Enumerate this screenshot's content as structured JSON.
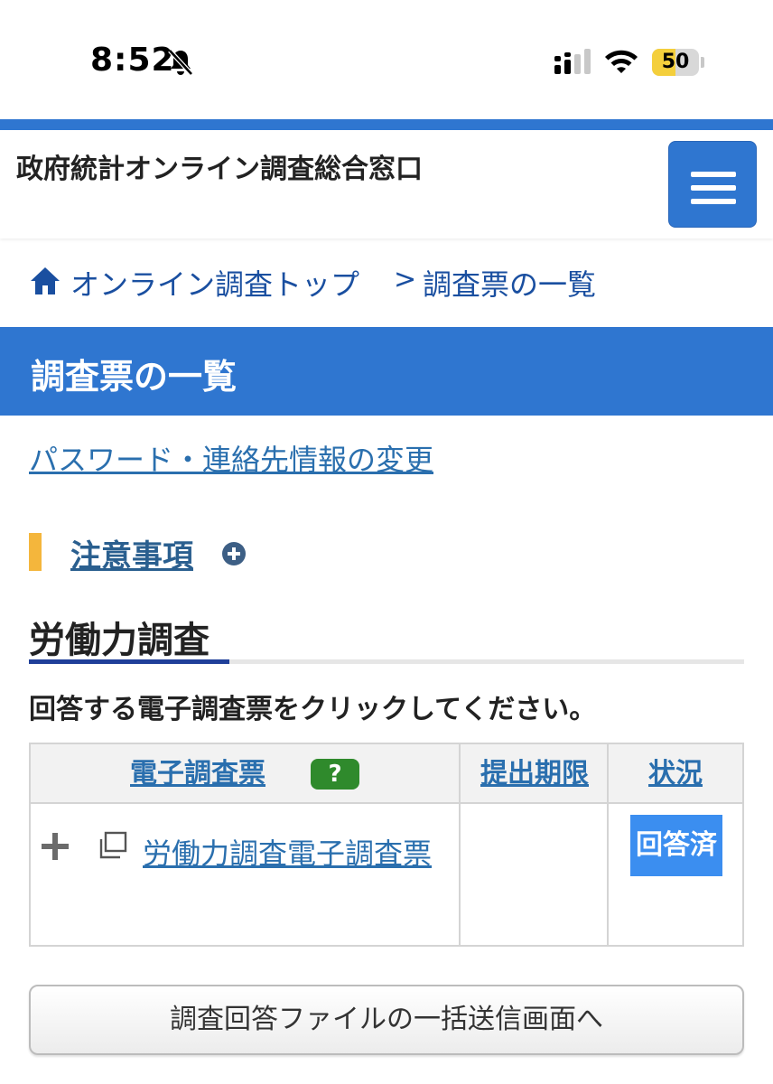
{
  "status_bar": {
    "time": "8:52",
    "battery_level": "50",
    "battery_percent": 50,
    "icons": [
      "bell-slash-icon",
      "cellular-signal-icon",
      "wifi-icon",
      "battery-icon"
    ]
  },
  "header": {
    "site_title": "政府統計オンライン調査総合窓口",
    "menu_icon": "hamburger-menu-icon"
  },
  "breadcrumb": {
    "home_label": "オンライン調査トップ",
    "separator": ">",
    "current": "調査票の一覧"
  },
  "page_title": "調査票の一覧",
  "password_link": "パスワード・連絡先情報の変更",
  "notice": {
    "label": "注意事項"
  },
  "section": {
    "title": "労働力調査",
    "instruction": "回答する電子調査票をクリックしてください。"
  },
  "table": {
    "headers": {
      "form": "電子調査票",
      "help": "?",
      "deadline": "提出期限",
      "status": "状況"
    },
    "rows": [
      {
        "form_name": "労働力調査電子調査票",
        "deadline": "",
        "status": "回答済"
      }
    ]
  },
  "bulk_button_label": "調査回答ファイルの一括送信画面へ",
  "colors": {
    "primary_blue": "#2f76d0",
    "link_blue": "#2a6fae",
    "notice_accent": "#f4b63c",
    "help_green": "#2f8a2c",
    "status_blue": "#3b8ef0"
  }
}
